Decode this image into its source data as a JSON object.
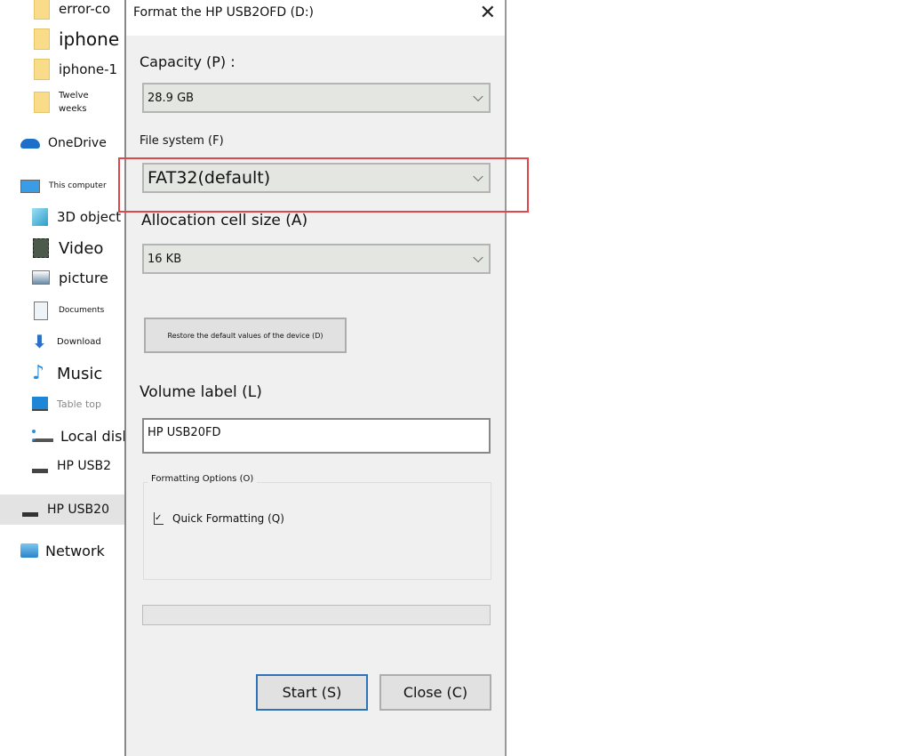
{
  "sidebar": {
    "items": [
      {
        "label": "error-co",
        "icon": "folder-icon"
      },
      {
        "label": "iphone",
        "icon": "folder-icon"
      },
      {
        "label": "iphone-1",
        "icon": "folder-icon"
      },
      {
        "label": "Twelve weeks",
        "icon": "folder-icon"
      },
      {
        "label": "OneDrive",
        "icon": "cloud-icon"
      },
      {
        "label": "This computer",
        "icon": "computer-icon"
      },
      {
        "label": "3D object",
        "icon": "cube-icon"
      },
      {
        "label": "Video",
        "icon": "film-icon"
      },
      {
        "label": "picture",
        "icon": "picture-icon"
      },
      {
        "label": "Documents",
        "icon": "document-icon"
      },
      {
        "label": "Download",
        "icon": "download-arrow-icon"
      },
      {
        "label": "Music",
        "icon": "music-note-icon"
      },
      {
        "label": "Table top",
        "icon": "desktop-icon"
      },
      {
        "label": "Local disk",
        "icon": "disk-icon"
      },
      {
        "label": "HP USB2",
        "icon": "usb-drive-icon"
      },
      {
        "label": "HP USB20",
        "icon": "usb-drive-icon",
        "selected": true
      },
      {
        "label": "Network",
        "icon": "network-icon"
      }
    ]
  },
  "dialog": {
    "title": "Format the HP USB2OFD (D:)",
    "capacity_label": "Capacity (P) :",
    "capacity_value": "28.9 GB",
    "filesystem_label": "File system (F)",
    "filesystem_value": "FAT32(default)",
    "allocation_label": "Allocation cell size (A)",
    "allocation_value": "16 KB",
    "restore_button": "Restore the default values of the device (D)",
    "volume_label": "Volume label (L)",
    "volume_value": "HP USB20FD",
    "options_group": "Formatting Options (O)",
    "quick_format": "Quick Formatting (Q)",
    "quick_format_checked": true,
    "progress": 0,
    "start_button": "Start (S)",
    "close_button": "Close (C)",
    "highlight_color": "#e0474c"
  }
}
